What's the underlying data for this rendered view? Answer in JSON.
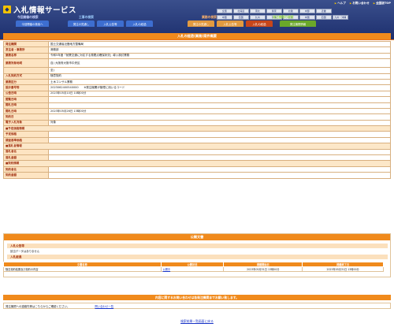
{
  "header": {
    "title": "入札情報サービス",
    "toplinks": [
      "ヘルプ",
      "お問い合わせ",
      "全国版TOP"
    ],
    "regions_row1": [
      "全国",
      "北海道",
      "東北",
      "関東",
      "北陸",
      "中部",
      "近畿"
    ],
    "regions_row2": [
      "中国",
      "四国",
      "九州",
      "沖縄",
      "近畿",
      "中国",
      "四国",
      "九州・沖縄"
    ]
  },
  "categories": {
    "a": "今回開催の検索",
    "b": "工事の検索",
    "c": "業務の検索",
    "d": "発注機関の検索"
  },
  "tabs": [
    "今回開催の検索へ",
    "発注の見通し",
    "入札公告等",
    "入札の経過",
    "発注の見通し",
    "入札公告等",
    "入札の経過",
    "発注機関情報"
  ],
  "main": {
    "title": "入札の経過(業務)案件概要",
    "rows": [
      {
        "k": "発注機関",
        "v": "国土交通省近畿地方整備局"
      },
      {
        "k": "发注者・事務所",
        "v": "港務部"
      },
      {
        "k": "業務名称",
        "v": "令和5年度「就業交通に対応する発着点確保状況」導入検討業務"
      },
      {
        "k": "業務対象地域",
        "v": "自) 大阪府大阪市中央区",
        "v2": "至)"
      },
      {
        "k": "入札契約方式",
        "v": "随意契約"
      },
      {
        "k": "業務区分",
        "v": "土木コンサル業務"
      },
      {
        "k": "設計番号等",
        "v": "2023062400540000",
        "note": "※発注機関が管理に用いるコード"
      },
      {
        "k": "公告日時",
        "v": "2023年05月10日 10時00分"
      },
      {
        "k": "閲覧日時",
        "v": ""
      },
      {
        "k": "開札日時",
        "v": ""
      },
      {
        "k": "開札日時",
        "v": "2023年05月26日 13時00分"
      },
      {
        "k": "契約日",
        "v": ""
      },
      {
        "k": "電子入札対象",
        "v": "対象"
      }
    ],
    "section_yotei": "■予定価格情報",
    "yotei_rows": [
      {
        "k": "予定価格",
        "v": ""
      },
      {
        "k": "調査基準価格",
        "v": ""
      }
    ],
    "section_rakusatsu": "■落札者情報",
    "rakusatsu_rows": [
      {
        "k": "落札者名",
        "v": ""
      },
      {
        "k": "落札金額",
        "v": ""
      }
    ],
    "section_keiyaku": "■契約情報",
    "keiyaku_rows": [
      {
        "k": "契約者名",
        "v": ""
      },
      {
        "k": "契約金額",
        "v": ""
      }
    ]
  },
  "docs": {
    "title": "公開文書",
    "sub1": "入札公告等",
    "sub1_text": "該当データはありません",
    "sub2": "入札経過",
    "headers": [
      "文書名称",
      "公開状況",
      "掲載開始日",
      "掲載終了日"
    ],
    "row": [
      "随意契約結果及び契約の内容",
      "公開中",
      "2023年05月31日 13時00分",
      "2023年05月31日 13時00分"
    ]
  },
  "notice": "内容に関するお問い合わせは各発注機関までお願い致します。",
  "contact": {
    "text": "発注機関への連絡先等はこちらからご確認ください。",
    "link": "問い合わせ一覧"
  },
  "back_link": "検索結果一覧画面に戻る",
  "colors": {
    "header_bg": "#1d2f6e",
    "accent_orange": "#f08a1c",
    "key_bg": "#fde4c2",
    "link": "#1a35c7"
  }
}
